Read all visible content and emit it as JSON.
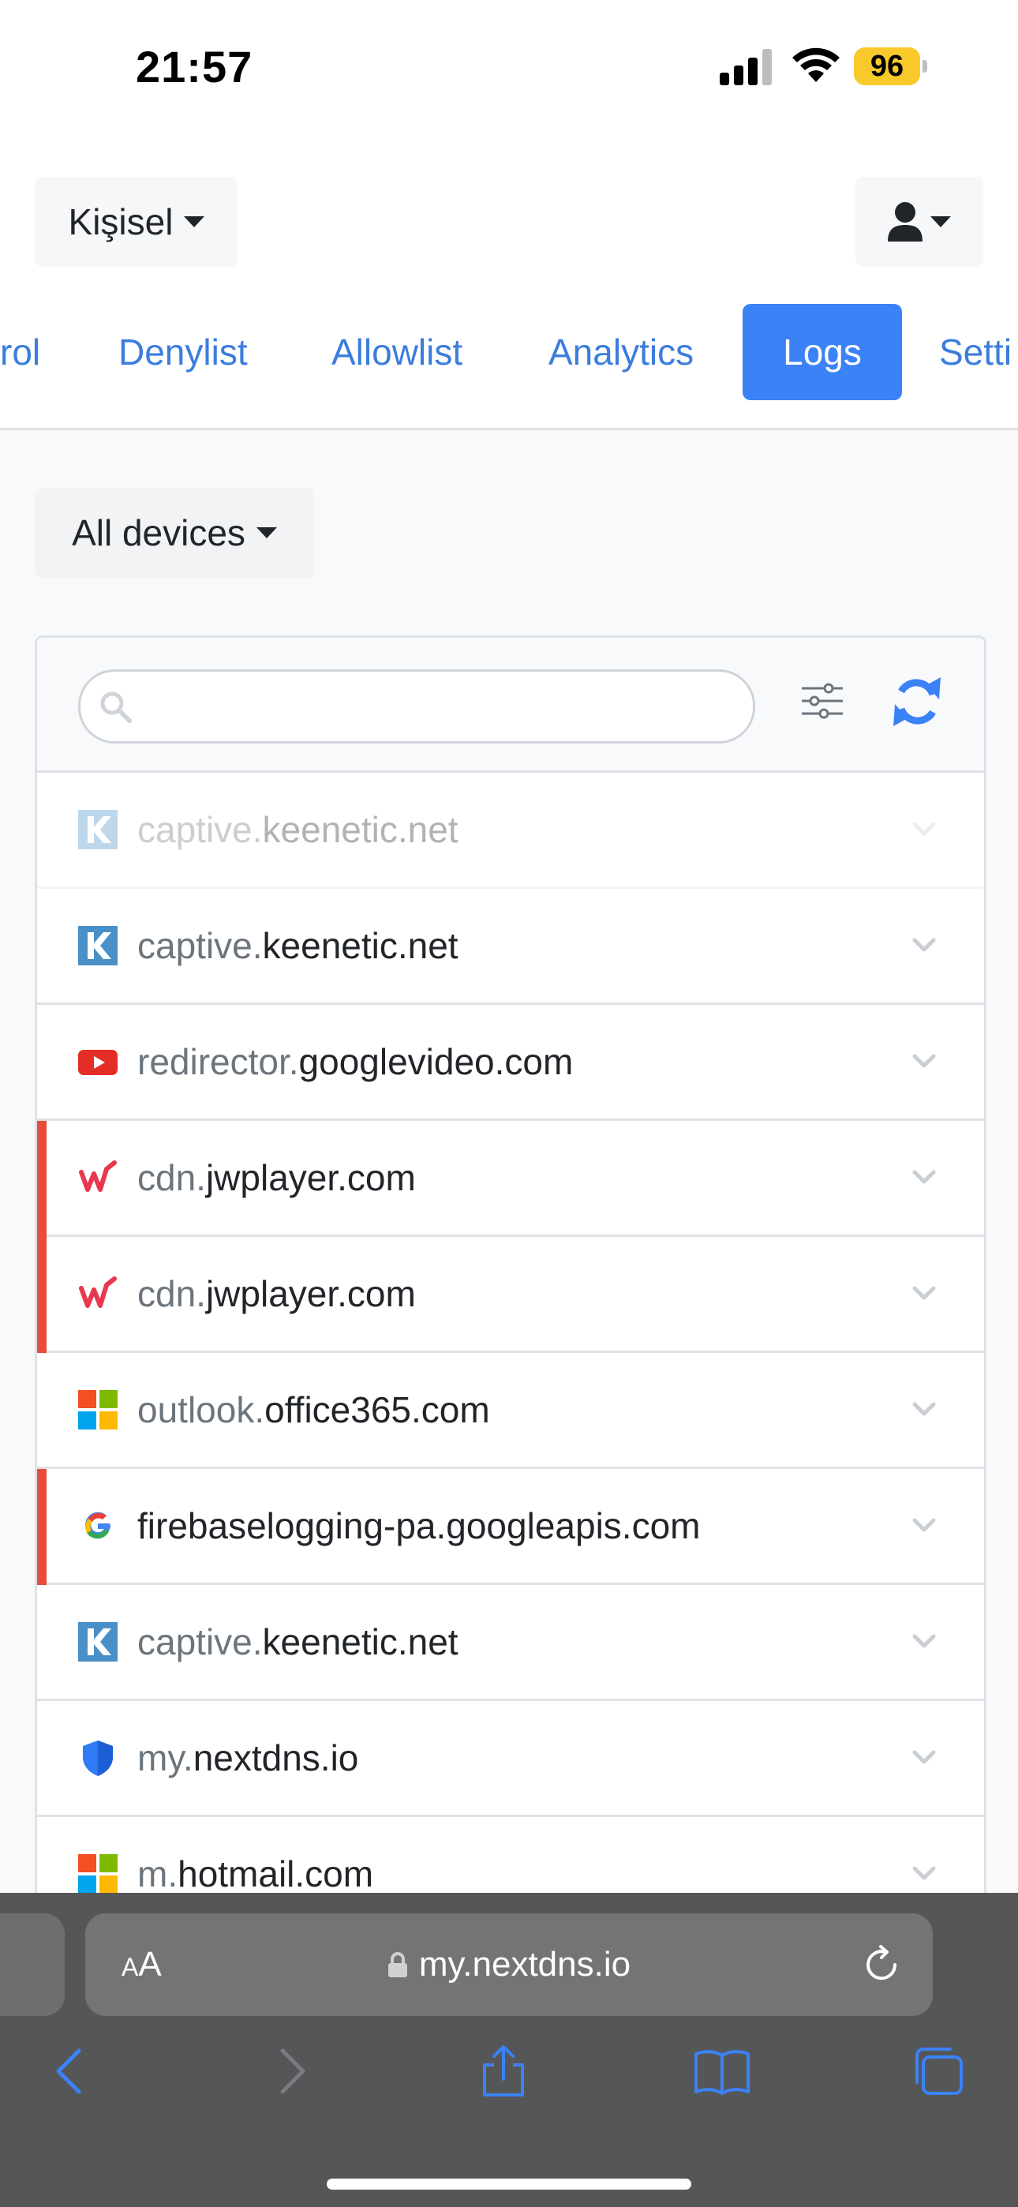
{
  "status_bar": {
    "time": "21:57",
    "battery": "96",
    "icons": [
      "signal-icon",
      "wifi-icon",
      "battery-icon"
    ]
  },
  "header": {
    "profile_label": "Kişisel",
    "user_icon": "user-icon"
  },
  "nav": {
    "tabs": [
      {
        "label": "rol"
      },
      {
        "label": "Denylist"
      },
      {
        "label": "Allowlist"
      },
      {
        "label": "Analytics"
      },
      {
        "label": "Logs",
        "active": true
      },
      {
        "label": "Setti"
      }
    ]
  },
  "filters": {
    "devices_label": "All devices",
    "search_placeholder": "",
    "search_value": ""
  },
  "logs": [
    {
      "sub": "captive.",
      "root": "keenetic.net",
      "icon": "keenetic-icon",
      "blocked": false,
      "faded": true
    },
    {
      "sub": "captive.",
      "root": "keenetic.net",
      "icon": "keenetic-icon",
      "blocked": false,
      "faded": false
    },
    {
      "sub": "redirector.",
      "root": "googlevideo.com",
      "icon": "youtube-icon",
      "blocked": false,
      "faded": false
    },
    {
      "sub": "cdn.",
      "root": "jwplayer.com",
      "icon": "jwplayer-icon",
      "blocked": true,
      "faded": false
    },
    {
      "sub": "cdn.",
      "root": "jwplayer.com",
      "icon": "jwplayer-icon",
      "blocked": true,
      "faded": false
    },
    {
      "sub": "outlook.",
      "root": "office365.com",
      "icon": "microsoft-icon",
      "blocked": false,
      "faded": false
    },
    {
      "sub": "",
      "root": "firebaselogging-pa.googleapis.com",
      "icon": "google-icon",
      "blocked": true,
      "faded": false
    },
    {
      "sub": "captive.",
      "root": "keenetic.net",
      "icon": "keenetic-icon",
      "blocked": false,
      "faded": false
    },
    {
      "sub": "my.",
      "root": "nextdns.io",
      "icon": "nextdns-shield-icon",
      "blocked": false,
      "faded": false
    },
    {
      "sub": "m.",
      "root": "hotmail.com",
      "icon": "microsoft-icon",
      "blocked": false,
      "faded": false
    }
  ],
  "colors": {
    "accent": "#3b82f6",
    "link": "#3b7ddd",
    "blocked": "#e74c3c",
    "battery": "#f8c92b"
  },
  "browser": {
    "aa_big": "A",
    "aa_small": "A",
    "url": "my.nextdns.io"
  }
}
